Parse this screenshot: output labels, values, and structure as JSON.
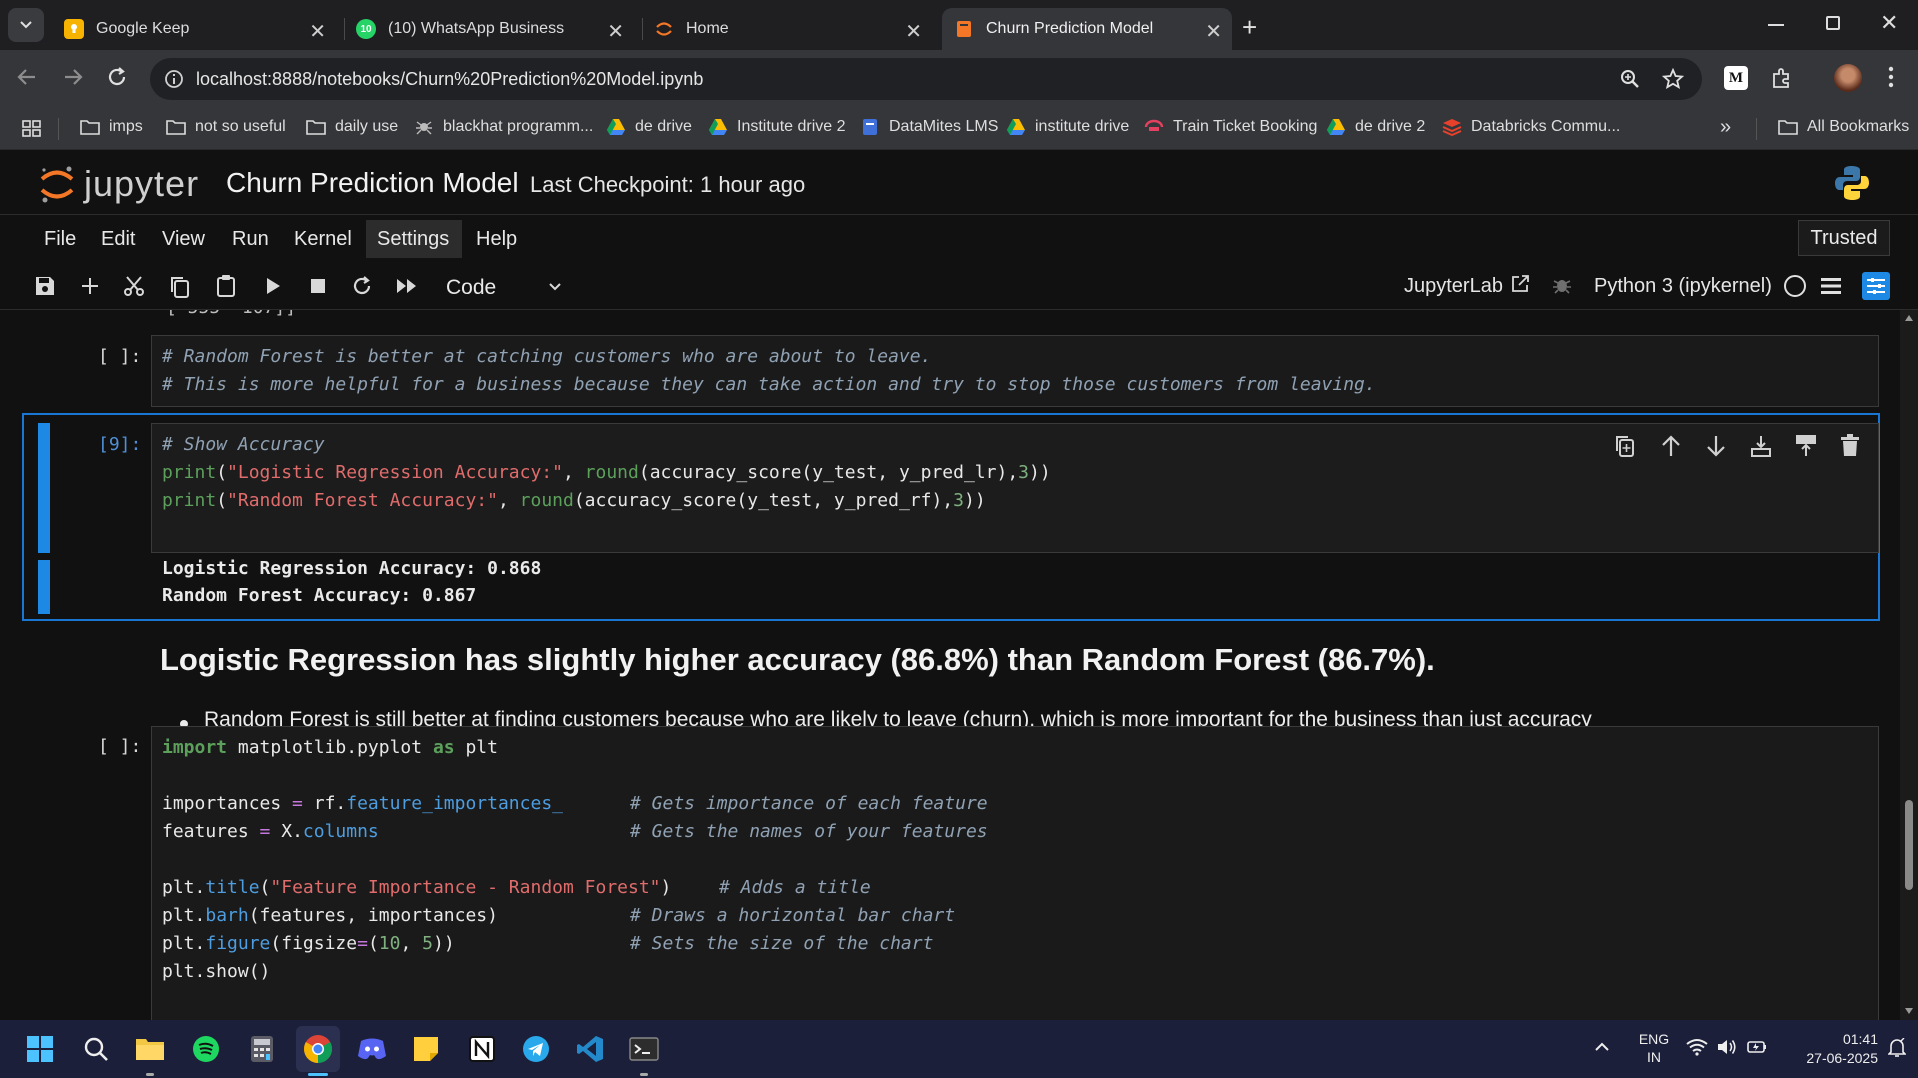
{
  "browser": {
    "tabs": [
      {
        "title": "Google Keep",
        "active": false
      },
      {
        "title": "(10) WhatsApp Business",
        "active": false,
        "badge": "10"
      },
      {
        "title": "Home",
        "active": false
      },
      {
        "title": "Churn Prediction Model",
        "active": true
      }
    ],
    "url": "localhost:8888/notebooks/Churn%20Prediction%20Model.ipynb",
    "profile_letter": "M",
    "bookmarks": [
      {
        "label": "imps",
        "icon": "folder-icon"
      },
      {
        "label": "not so useful",
        "icon": "folder-icon"
      },
      {
        "label": "daily use",
        "icon": "folder-icon"
      },
      {
        "label": "blackhat programm...",
        "icon": "bug-icon"
      },
      {
        "label": "de drive",
        "icon": "drive-icon"
      },
      {
        "label": "Institute drive 2",
        "icon": "drive-icon"
      },
      {
        "label": "DataMites LMS",
        "icon": "book-icon"
      },
      {
        "label": "institute drive",
        "icon": "drive-icon"
      },
      {
        "label": "Train Ticket Booking",
        "icon": "train-icon"
      },
      {
        "label": "de drive 2",
        "icon": "drive-icon"
      },
      {
        "label": "Databricks Commu...",
        "icon": "databricks-icon"
      }
    ],
    "all_bookmarks": "All Bookmarks"
  },
  "jupyter": {
    "logo_text": "jupyter",
    "notebook_title": "Churn Prediction Model",
    "checkpoint": "Last Checkpoint: 1 hour ago",
    "trusted": "Trusted",
    "menu": [
      "File",
      "Edit",
      "View",
      "Run",
      "Kernel",
      "Settings",
      "Help"
    ],
    "cell_type": "Code",
    "jupyterlab_link": "JupyterLab",
    "kernel": "Python 3 (ipykernel)"
  },
  "cells": {
    "c1": {
      "prompt": "[ ]:",
      "lines": [
        "# Random Forest is better at catching customers who are about to leave.",
        "# This is more helpful for a business because they can take action and try to stop those customers from leaving."
      ]
    },
    "c2": {
      "prompt": "[9]:",
      "comment": "# Show Accuracy",
      "print1_a": "print",
      "print1_b": "(",
      "print1_str": "\"Logistic Regression Accuracy:\"",
      "print1_c": ", ",
      "print1_round": "round",
      "print1_d": "(accuracy_score(y_test, y_pred_lr),",
      "print1_num": "3",
      "print1_e": "))",
      "print2_a": "print",
      "print2_b": "(",
      "print2_str": "\"Random Forest Accuracy:\"",
      "print2_c": ", ",
      "print2_round": "round",
      "print2_d": "(accuracy_score(y_test, y_pred_rf),",
      "print2_num": "3",
      "print2_e": "))",
      "output": [
        "Logistic Regression Accuracy: 0.868",
        "Random Forest Accuracy: 0.867"
      ]
    },
    "md": {
      "heading": "Logistic Regression has slightly higher accuracy (86.8%) than Random Forest (86.7%).",
      "bullet": "Random Forest is still better at finding customers because who are likely to leave (churn), which is more important for the business than just accuracy"
    },
    "c3": {
      "prompt": "[ ]:",
      "l1_kw1": "import",
      "l1_mid": " matplotlib.pyplot ",
      "l1_kw2": "as",
      "l1_end": " plt",
      "l3_a": "importances ",
      "l3_op": "=",
      "l3_b": " rf.",
      "l3_attr": "feature_importances_",
      "l3_cm": "# Gets importance of each feature",
      "l4_a": "features ",
      "l4_op": "=",
      "l4_b": " X.",
      "l4_attr": "columns",
      "l4_cm": "# Gets the names of your features",
      "l6_a": "plt.",
      "l6_attr": "title",
      "l6_b": "(",
      "l6_str": "\"Feature Importance - Random Forest\"",
      "l6_c": ")",
      "l6_cm": "# Adds a title",
      "l7_a": "plt.",
      "l7_attr": "barh",
      "l7_b": "(features, importances)",
      "l7_cm": "# Draws a horizontal bar chart",
      "l8_a": "plt.",
      "l8_attr": "figure",
      "l8_b": "(figsize",
      "l8_op": "=",
      "l8_c": "(",
      "l8_n1": "10",
      "l8_d": ", ",
      "l8_n2": "5",
      "l8_e": "))",
      "l8_cm": "# Sets the size of the chart",
      "l9": "plt.show()"
    }
  },
  "taskbar": {
    "lang1": "ENG",
    "lang2": "IN",
    "time": "01:41",
    "date": "27-06-2025"
  },
  "colors": {
    "accent": "#1e88e5",
    "cell_selected": "#1976d2",
    "taskbar": "#1c1f3a"
  }
}
